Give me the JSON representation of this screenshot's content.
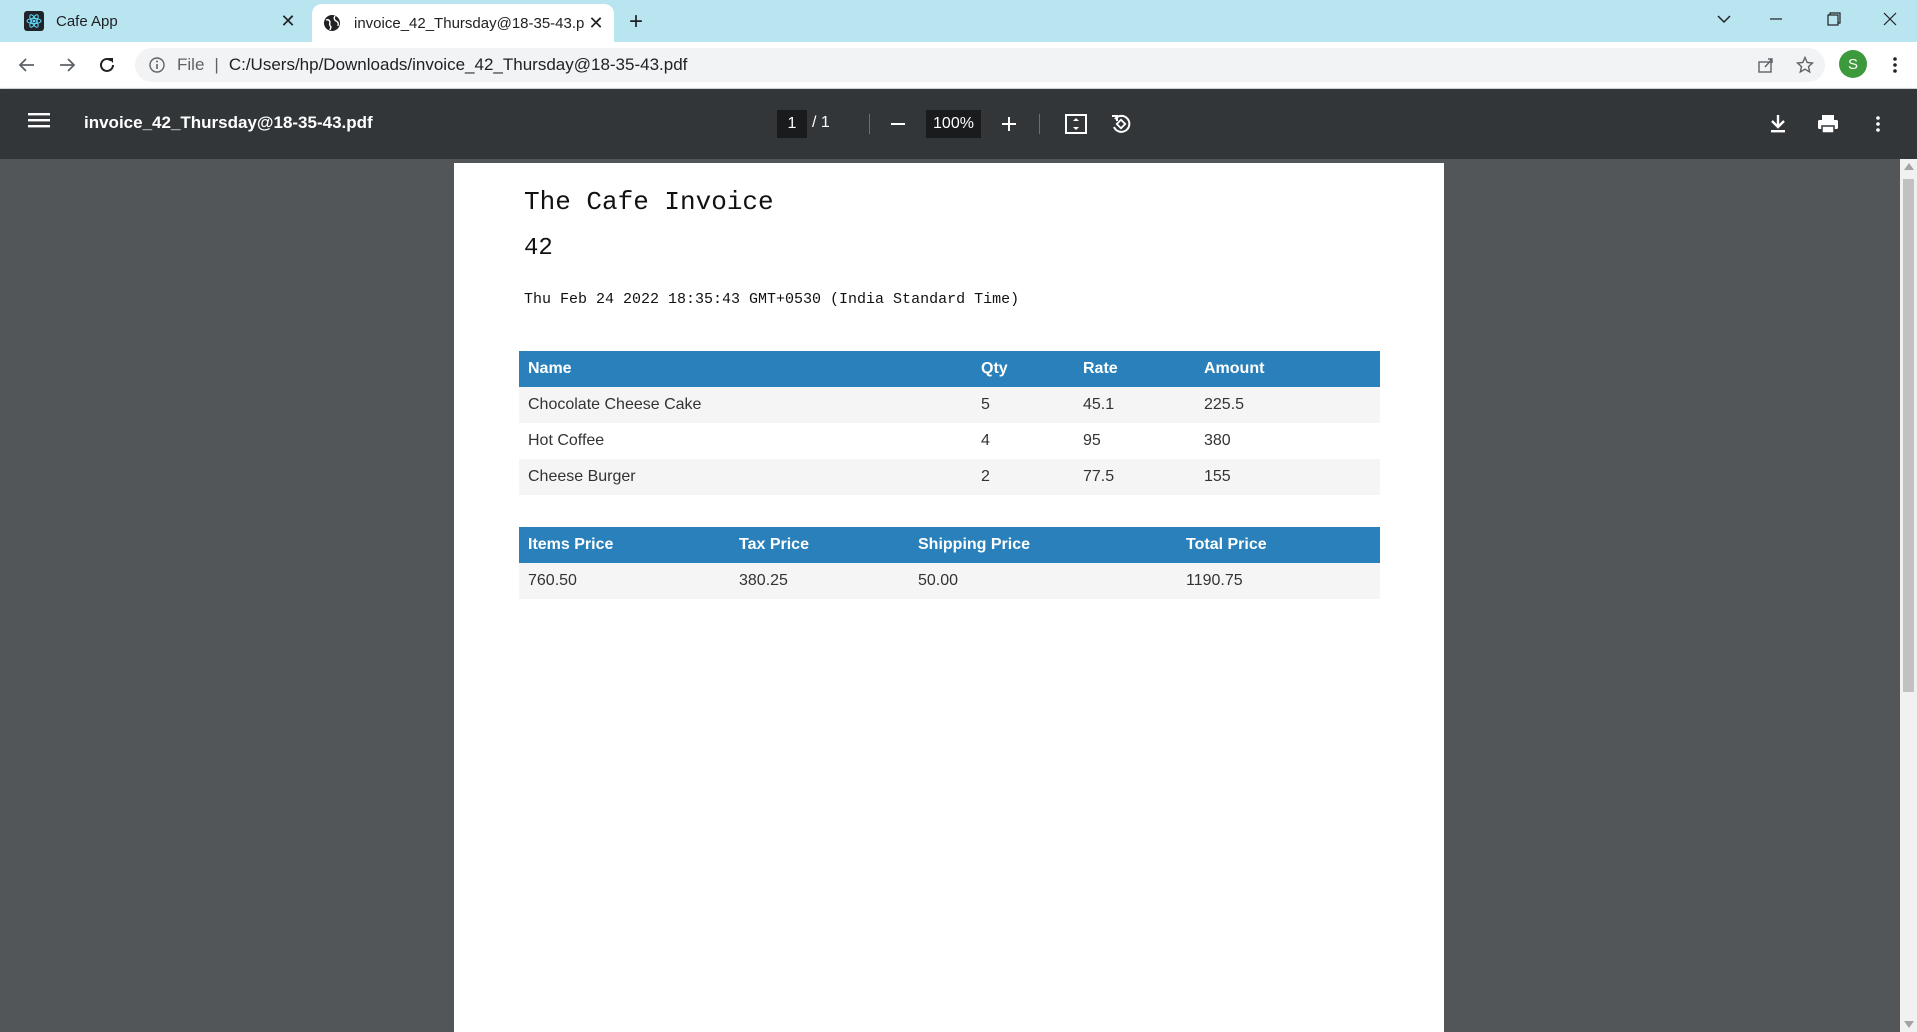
{
  "browser": {
    "tabs": [
      {
        "title": "Cafe App",
        "icon": "react-icon"
      },
      {
        "title": "invoice_42_Thursday@18-35-43.pdf",
        "icon": "globe-icon"
      }
    ],
    "address": {
      "scheme": "File",
      "url": "C:/Users/hp/Downloads/invoice_42_Thursday@18-35-43.pdf"
    },
    "avatar_initial": "S"
  },
  "pdf_viewer": {
    "filename": "invoice_42_Thursday@18-35-43.pdf",
    "current_page": "1",
    "page_separator": "/ 1",
    "zoom": "100%"
  },
  "invoice": {
    "title": "The Cafe Invoice",
    "number": "42",
    "date": "Thu Feb 24 2022 18:35:43 GMT+0530 (India Standard Time)",
    "items_headers": [
      "Name",
      "Qty",
      "Rate",
      "Amount"
    ],
    "items": [
      [
        "Chocolate Cheese Cake",
        "5",
        "45.1",
        "225.5"
      ],
      [
        "Hot Coffee",
        "4",
        "95",
        "380"
      ],
      [
        "Cheese Burger",
        "2",
        "77.5",
        "155"
      ]
    ],
    "totals_headers": [
      "Items Price",
      "Tax Price",
      "Shipping Price",
      "Total Price"
    ],
    "totals": [
      "760.50",
      "380.25",
      "50.00",
      "1190.75"
    ],
    "table_header_color": "#2980ba"
  }
}
